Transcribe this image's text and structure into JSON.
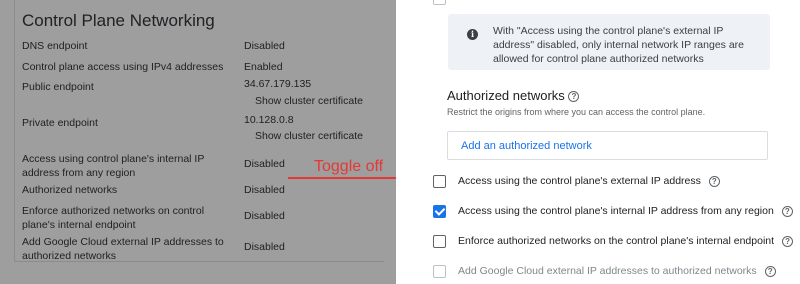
{
  "left": {
    "title": "Control Plane Networking",
    "rows": [
      {
        "label": "DNS endpoint",
        "value": "Disabled"
      },
      {
        "label": "Control plane access using IPv4 addresses",
        "value": "Enabled"
      },
      {
        "label": "Public endpoint",
        "value": "34.67.179.135",
        "link": "Show cluster certificate"
      },
      {
        "label": "Private endpoint",
        "value": "10.128.0.8",
        "link": "Show cluster certificate"
      },
      {
        "label": "Access using control plane's internal IP address from any region",
        "value": "Disabled"
      },
      {
        "label": "Authorized networks",
        "value": "Disabled"
      },
      {
        "label": "Enforce authorized networks on control plane's internal endpoint",
        "value": "Disabled"
      },
      {
        "label": "Add Google Cloud external IP addresses to authorized networks",
        "value": "Disabled"
      }
    ]
  },
  "annotation": {
    "text": "Toggle off",
    "color": "#e53935"
  },
  "right": {
    "info_text": "With \"Access using the control plane's external IP address\" disabled, only internal network IP ranges are allowed for control plane authorized networks",
    "auth_title": "Authorized networks",
    "auth_desc": "Restrict the origins from where you can access the control plane.",
    "add_network_label": "Add an authorized network",
    "checkboxes": [
      {
        "label": "Access using the control plane's external IP address",
        "checked": false,
        "disabled": false
      },
      {
        "label": "Access using the control plane's internal IP address from any region",
        "checked": true,
        "disabled": false
      },
      {
        "label": "Enforce authorized networks on the control plane's internal endpoint",
        "checked": false,
        "disabled": false
      },
      {
        "label": "Add Google Cloud external IP addresses to authorized networks",
        "checked": false,
        "disabled": true
      }
    ]
  },
  "icons": {
    "info": "info-icon",
    "help": "help-circle-icon",
    "arrow": "arrow-right-icon"
  },
  "colors": {
    "accent": "#1a73e8",
    "annotation": "#e53935",
    "overlay": "#9e9e9e"
  }
}
